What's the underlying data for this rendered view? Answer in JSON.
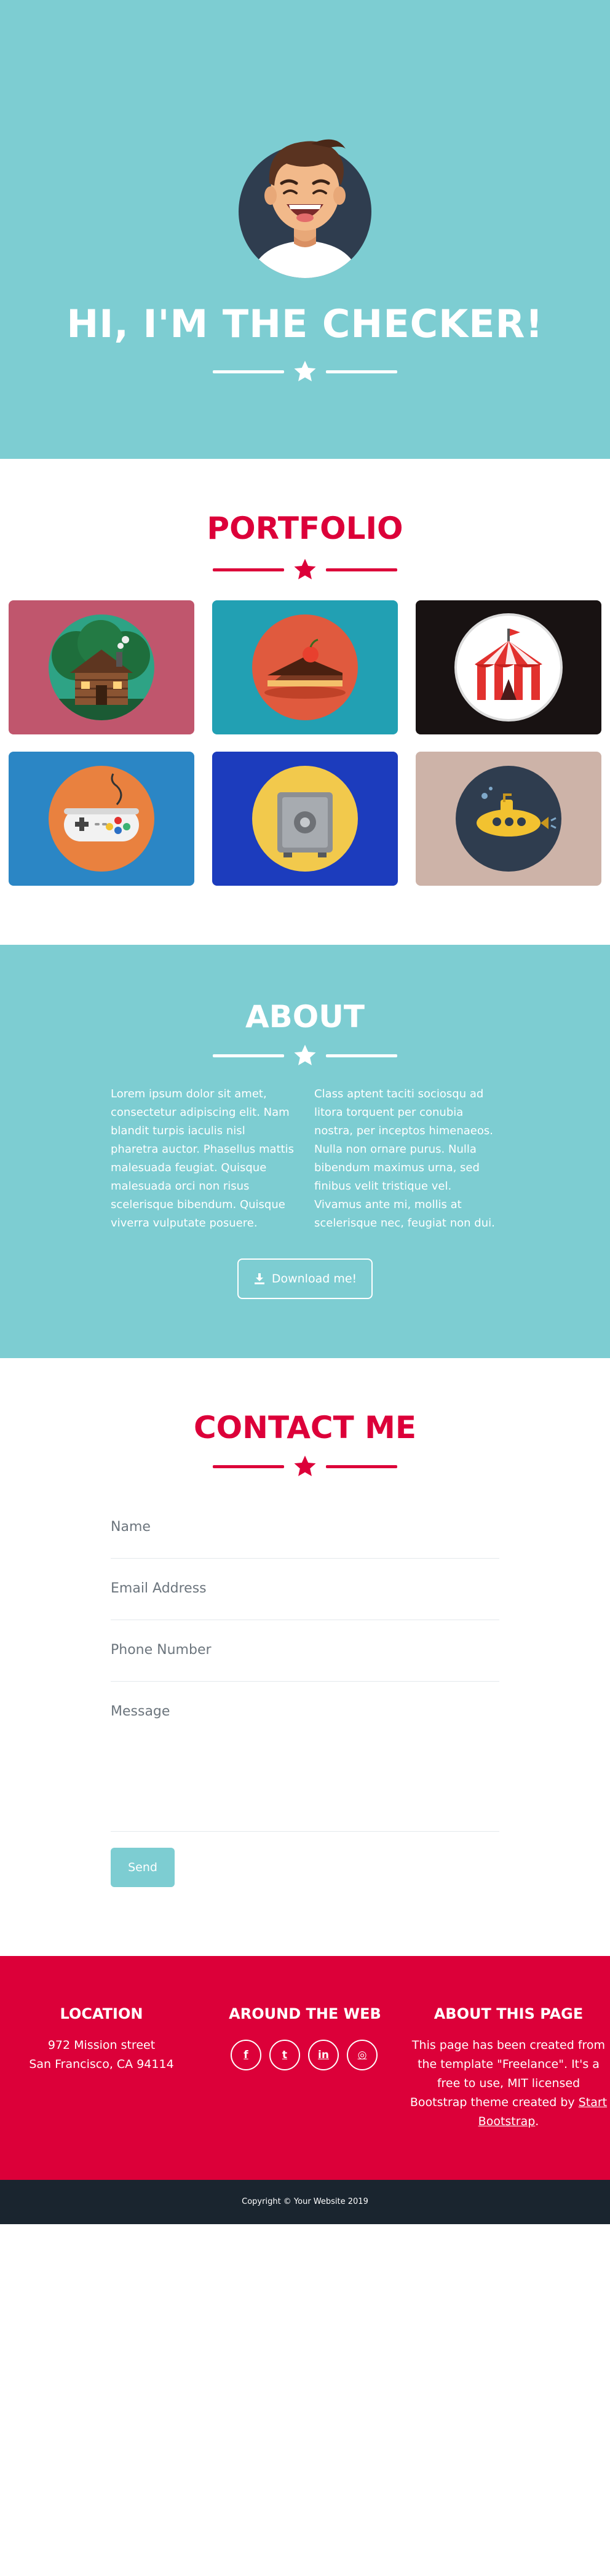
{
  "colors": {
    "teal": "#7dcdd2",
    "crimson": "#dc0039",
    "dark": "#1a252f",
    "white": "#ffffff"
  },
  "masthead": {
    "title": "HI, I'M THE CHECKER!",
    "avatar_icon": "avatar-icon",
    "divider_icon": "star-icon"
  },
  "portfolio": {
    "title": "PORTFOLIO",
    "items": [
      {
        "icon": "cabin-icon",
        "bg": "#c0566d"
      },
      {
        "icon": "cake-icon",
        "bg": "#22a0b3"
      },
      {
        "icon": "circus-tent-icon",
        "bg": "#181212"
      },
      {
        "icon": "game-controller-icon",
        "bg": "#2b86c5"
      },
      {
        "icon": "safe-icon",
        "bg": "#1c3cbd"
      },
      {
        "icon": "submarine-icon",
        "bg": "#cdb3a8"
      }
    ]
  },
  "about": {
    "title": "ABOUT",
    "col1": "Lorem ipsum dolor sit amet, consectetur adipiscing elit. Nam blandit turpis iaculis nisl pharetra auctor. Phasellus mattis malesuada feugiat. Quisque malesuada orci non risus scelerisque bibendum. Quisque viverra vulputate posuere.",
    "col2": "Class aptent taciti sociosqu ad litora torquent per conubia nostra, per inceptos himenaeos. Nulla non ornare purus. Nulla bibendum maximus urna, sed finibus velit tristique vel. Vivamus ante mi, mollis at scelerisque nec, feugiat non dui.",
    "download_label": "Download me!"
  },
  "contact": {
    "title": "CONTACT ME",
    "name_placeholder": "Name",
    "email_placeholder": "Email Address",
    "phone_placeholder": "Phone Number",
    "message_placeholder": "Message",
    "send_label": "Send"
  },
  "footer": {
    "location": {
      "heading": "LOCATION",
      "line1": "972 Mission street",
      "line2": "San Francisco, CA 94114"
    },
    "web": {
      "heading": "AROUND THE WEB",
      "links": [
        {
          "icon": "facebook-icon",
          "glyph": "f"
        },
        {
          "icon": "twitter-icon",
          "glyph": "t"
        },
        {
          "icon": "linkedin-icon",
          "glyph": "in"
        },
        {
          "icon": "dribbble-icon",
          "glyph": "◎"
        }
      ]
    },
    "about": {
      "heading": "ABOUT THIS PAGE",
      "line1": "This page has been created from",
      "line2": "the template \"Freelance\". It's a",
      "line3": "free to use, MIT licensed",
      "line4_text": "Bootstrap theme created by ",
      "line4_link": "Start",
      "line5_link": "Bootstrap",
      "line5_end": "."
    }
  },
  "copyright": "Copyright © Your Website 2019"
}
